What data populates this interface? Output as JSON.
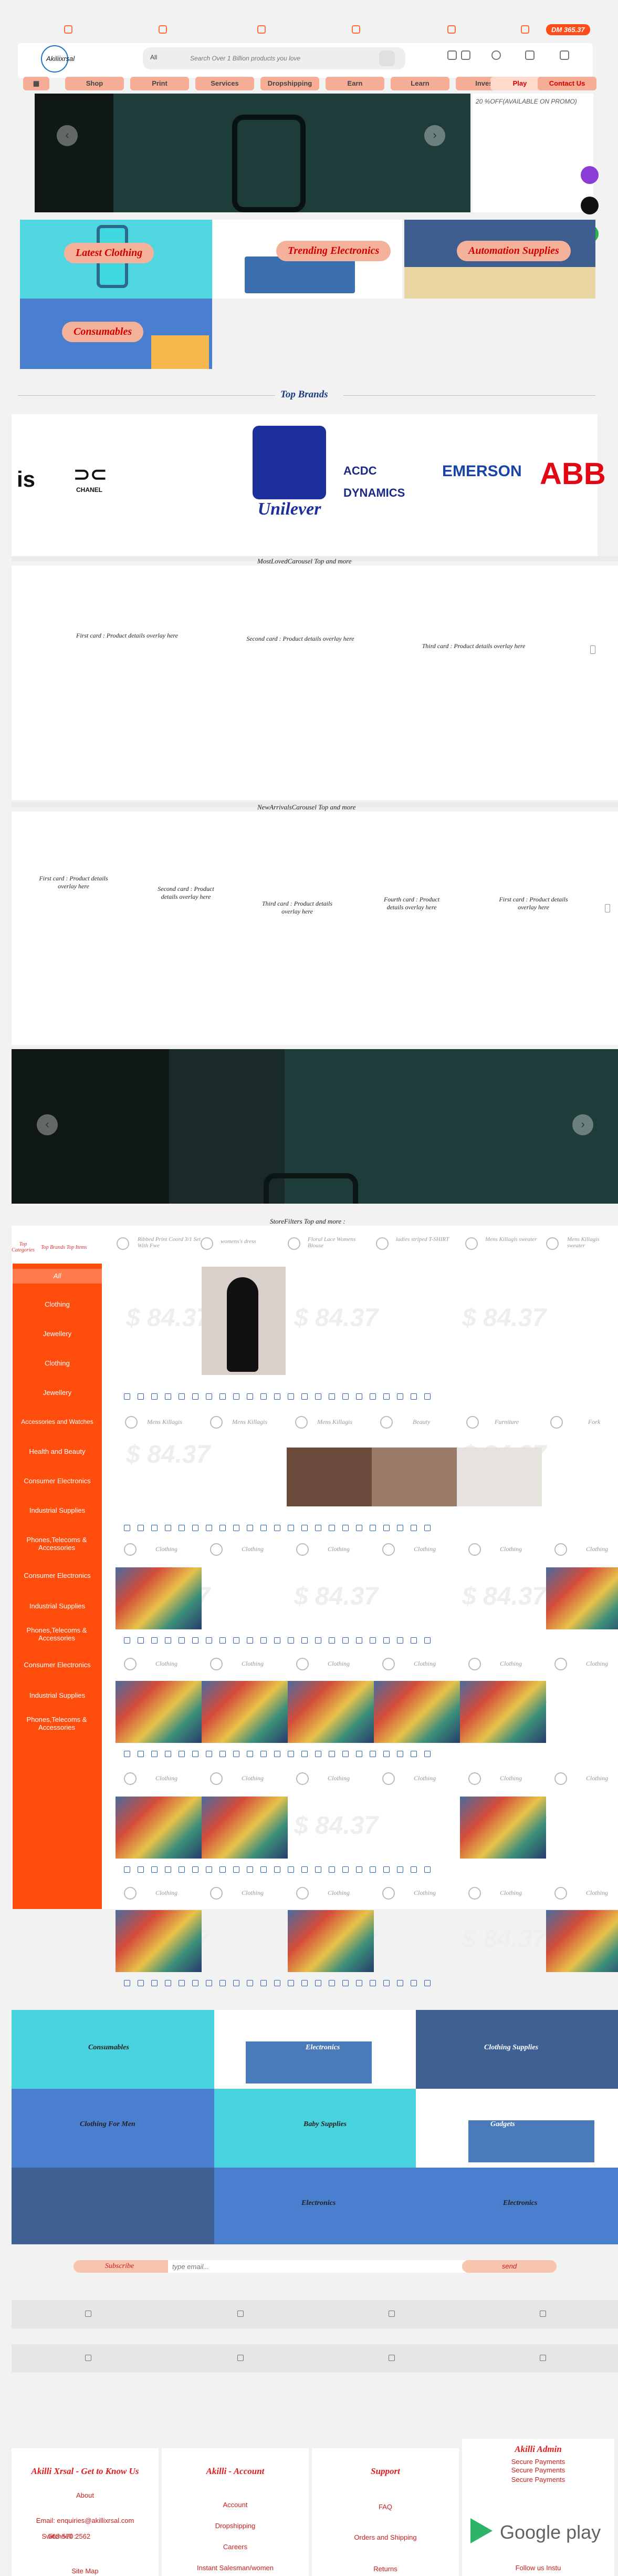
{
  "top_strip": {
    "balance": "DM 365.37"
  },
  "header": {
    "logo_text": "Akiliixrsal",
    "search": {
      "category": "All",
      "placeholder": "Search Over 1 Billion products you love"
    }
  },
  "nav": {
    "items": [
      "Shop",
      "Print",
      "Services",
      "Dropshipping",
      "Earn",
      "Learn",
      "Invest",
      "Play",
      "Contact Us"
    ]
  },
  "hero": {
    "promo": "20 %OFF(AVAILABLE ON PROMO)"
  },
  "category_tiles": [
    "Latest Clothing",
    "Trending Electronics",
    "Automation Supplies",
    "Consumables"
  ],
  "brands": {
    "title": "Top Brands",
    "items": [
      "CHANEL",
      "Unilever",
      "ACDC DYNAMICS",
      "EMERSON",
      "ABB"
    ]
  },
  "carousel1": {
    "title": "MostLovedCarousel Top and more",
    "cards": [
      "First card : Product details overlay here",
      "Second card : Product details overlay here",
      "Third card : Product details overlay here"
    ]
  },
  "carousel2": {
    "title": "NewArrivalsCarousel Top and more",
    "cards": [
      "First card : Product details overlay here",
      "Second card : Product details overlay here",
      "Third card : Product details overlay here",
      "Fourth card : Product details overlay here",
      "First card : Product details overlay here"
    ]
  },
  "store": {
    "title": "StoreFilters Top and more :",
    "side_header": "Top Categories",
    "side_header2": "Top Brands Top Items",
    "categories": [
      "All",
      "Clothing",
      "Jewellery",
      "Clothing",
      "Jewellery",
      "Accessories and Watches",
      "Health and Beauty",
      "Consumer Electronics",
      "Industrial Supplies",
      "Phones,Telecoms & Accessories",
      "Consumer Electronics",
      "Industrial Supplies",
      "Phones,Telecoms & Accessories",
      "Consumer Electronics",
      "Industrial Supplies",
      "Phones,Telecoms & Accessories"
    ],
    "row1": [
      "Ribbed Print Coord 3/1 Set With Fwe",
      "womens's dress",
      "Floral Lace Womens Blouse",
      "ladies striped T-SHIRT",
      "Mens Killagis sweater",
      "Mens Killagis sweater"
    ],
    "row2": [
      "Mens Killagis",
      "Mens Killagis",
      "Mens Killagis",
      "Beauty",
      "Furniture",
      "Fork"
    ],
    "clothing": "Clothing",
    "price_ghost": "$ 84.37"
  },
  "mosaic": [
    "Consumables",
    "Electronics",
    "Clothing Supplies",
    "Clothing For Men",
    "Baby Supplies",
    "Gadgets",
    "Electronics",
    "Electronics"
  ],
  "subscribe": {
    "label": "Subscribe",
    "placeholder": "type email...",
    "button": "send"
  },
  "footer": {
    "about": {
      "title": "Akilli Xrsal - Get to Know Us",
      "heading": "About",
      "email": "Email: enquiries@akillixrsal.com",
      "switch_label": "Switchsell :",
      "switch_val": "568-570 2562",
      "site_map": "Site Map"
    },
    "account": {
      "title": "Akilli - Account",
      "items": [
        "Account",
        "Dropshipping",
        "Careers",
        "Instant Salesman/women"
      ]
    },
    "support": {
      "title": "Support",
      "items": [
        "FAQ",
        "Orders and Shipping",
        "Returns"
      ]
    },
    "admin": {
      "title": "Akilli Admin",
      "items": [
        "Secure Payments",
        "Secure Payments",
        "Secure Payments"
      ],
      "follow": "Follow us Instu"
    },
    "google_play": "Google play"
  }
}
